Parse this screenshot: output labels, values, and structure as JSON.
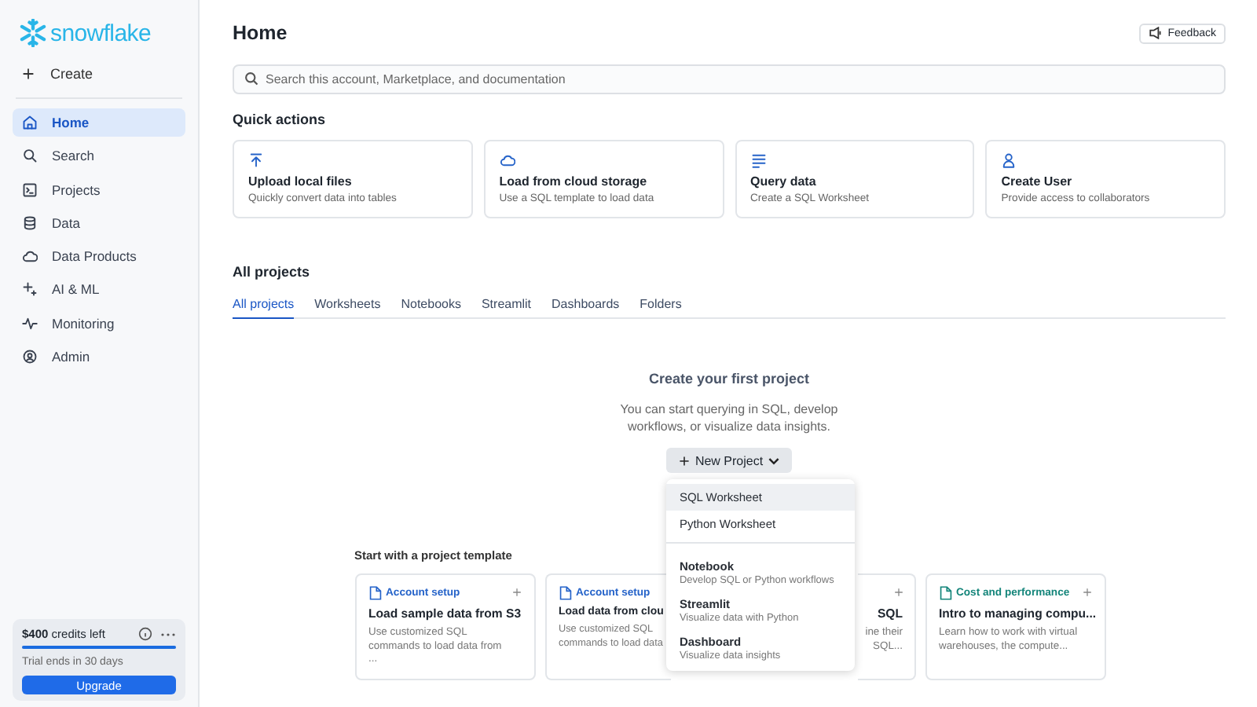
{
  "sidebar": {
    "logo": "snowflake",
    "create": "Create",
    "items": [
      {
        "label": "Home",
        "selected": true
      },
      {
        "label": "Search",
        "selected": false
      },
      {
        "label": "Projects",
        "selected": false
      },
      {
        "label": "Data",
        "selected": false
      },
      {
        "label": "Data Products",
        "selected": false
      },
      {
        "label": "AI & ML",
        "selected": false
      },
      {
        "label": "Monitoring",
        "selected": false
      },
      {
        "label": "Admin",
        "selected": false
      }
    ],
    "credits": {
      "amount": "$400",
      "label": "credits left",
      "level": 1,
      "trial": "Trial ends in 30 days",
      "button": "Upgrade"
    }
  },
  "header": {
    "title": "Home",
    "feedback": "Feedback"
  },
  "search": {
    "placeholder": "Search this account, Marketplace, and documentation"
  },
  "quick_actions": {
    "title": "Quick actions",
    "cards": [
      {
        "title": "Upload local files",
        "subtitle": "Quickly convert data into tables"
      },
      {
        "title": "Load from cloud storage",
        "subtitle": "Use a SQL template to load data"
      },
      {
        "title": "Query data",
        "subtitle": "Create a SQL Worksheet"
      },
      {
        "title": "Create User",
        "subtitle": "Provide access to collaborators"
      }
    ]
  },
  "projects": {
    "title": "All projects",
    "tabs": [
      {
        "label": "All projects",
        "selected": true
      },
      {
        "label": "Worksheets",
        "selected": false
      },
      {
        "label": "Notebooks",
        "selected": false
      },
      {
        "label": "Streamlit",
        "selected": false
      },
      {
        "label": "Dashboards",
        "selected": false
      },
      {
        "label": "Folders",
        "selected": false
      }
    ],
    "empty": {
      "title": "Create your first project",
      "text": "You can start querying in SQL, develop workflows, or visualize data insights.",
      "button": "New Project"
    }
  },
  "menu": {
    "items": [
      {
        "label": "SQL Worksheet",
        "selected": true
      },
      {
        "label": "Python Worksheet",
        "selected": false
      },
      {
        "label": "Notebook",
        "description": "Develop SQL or Python workflows",
        "selected": false
      },
      {
        "label": "Streamlit",
        "description": "Visualize data with Python",
        "selected": false
      },
      {
        "label": "Dashboard",
        "description": "Visualize data insights",
        "selected": false
      }
    ]
  },
  "templates": {
    "title": "Start with a project template",
    "cards": [
      {
        "category": "Account setup",
        "color": "#2563c9",
        "title": "Load sample data from S3",
        "text": "Use customized SQL commands to load data from ..."
      },
      {
        "category": "Account setup",
        "color": "#2563c9",
        "title": "Load data from clou",
        "text": "Use customized SQL commands to load data"
      },
      {
        "title": "SQL",
        "text": "ine their SQL..."
      },
      {
        "category": "Cost and performance",
        "color": "#14857a",
        "title": "Intro to managing compu...",
        "text": "Learn how to work with virtual warehouses, the compute..."
      }
    ]
  }
}
